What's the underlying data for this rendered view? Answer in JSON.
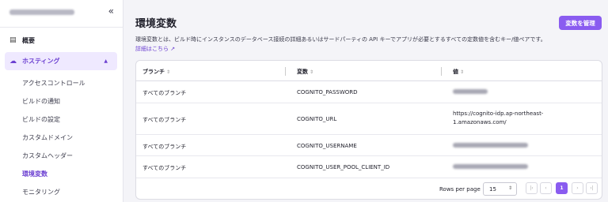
{
  "sidebar": {
    "collapse_icon": "double-chevron-left-icon",
    "overview": "概要",
    "hosting": "ホスティング",
    "sub_items": [
      "アクセスコントロール",
      "ビルドの通知",
      "ビルドの設定",
      "カスタムドメイン",
      "カスタムヘッダー",
      "環境変数",
      "モニタリング"
    ],
    "active_sub": "環境変数"
  },
  "main": {
    "title": "環境変数",
    "manage_button": "変数を管理",
    "description": "環境変数とは、ビルド時にインスタンスのデータベース接続の詳細あるいはサードパーティの API キーでアプリが必要とするすべての定数値を含むキー/値ペアです。",
    "detail_link": "詳細はこちら"
  },
  "table": {
    "headers": [
      "ブランチ",
      "変数",
      "値"
    ],
    "rows": [
      {
        "branch": "すべてのブランチ",
        "variable": "COGNITO_PASSWORD",
        "value": ""
      },
      {
        "branch": "すべてのブランチ",
        "variable": "COGNITO_URL",
        "value": "https://cognito-idp.ap-northeast-1.amazonaws.com/"
      },
      {
        "branch": "すべてのブランチ",
        "variable": "COGNITO_USERNAME",
        "value": ""
      },
      {
        "branch": "すべてのブランチ",
        "variable": "COGNITO_USER_POOL_CLIENT_ID",
        "value": ""
      }
    ]
  },
  "pagination": {
    "rows_per_page_label": "Rows per page",
    "rows_per_page": "15",
    "current_page": "1"
  },
  "colors": {
    "accent": "#8a5cf0",
    "active_text": "#6b3fd1"
  }
}
